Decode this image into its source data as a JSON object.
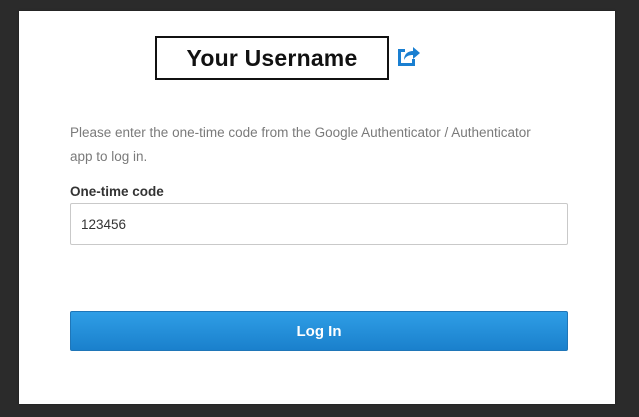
{
  "header": {
    "username": "Your Username",
    "switch_icon": "switch-account-icon"
  },
  "instructions": "Please enter the one-time code from the Google Authenticator / Authenticator app to log in.",
  "form": {
    "code_label": "One-time code",
    "code_value": "123456"
  },
  "actions": {
    "login_label": "Log In"
  },
  "colors": {
    "accent": "#1a80cc",
    "background": "#2b2b2b",
    "card": "#ffffff"
  }
}
